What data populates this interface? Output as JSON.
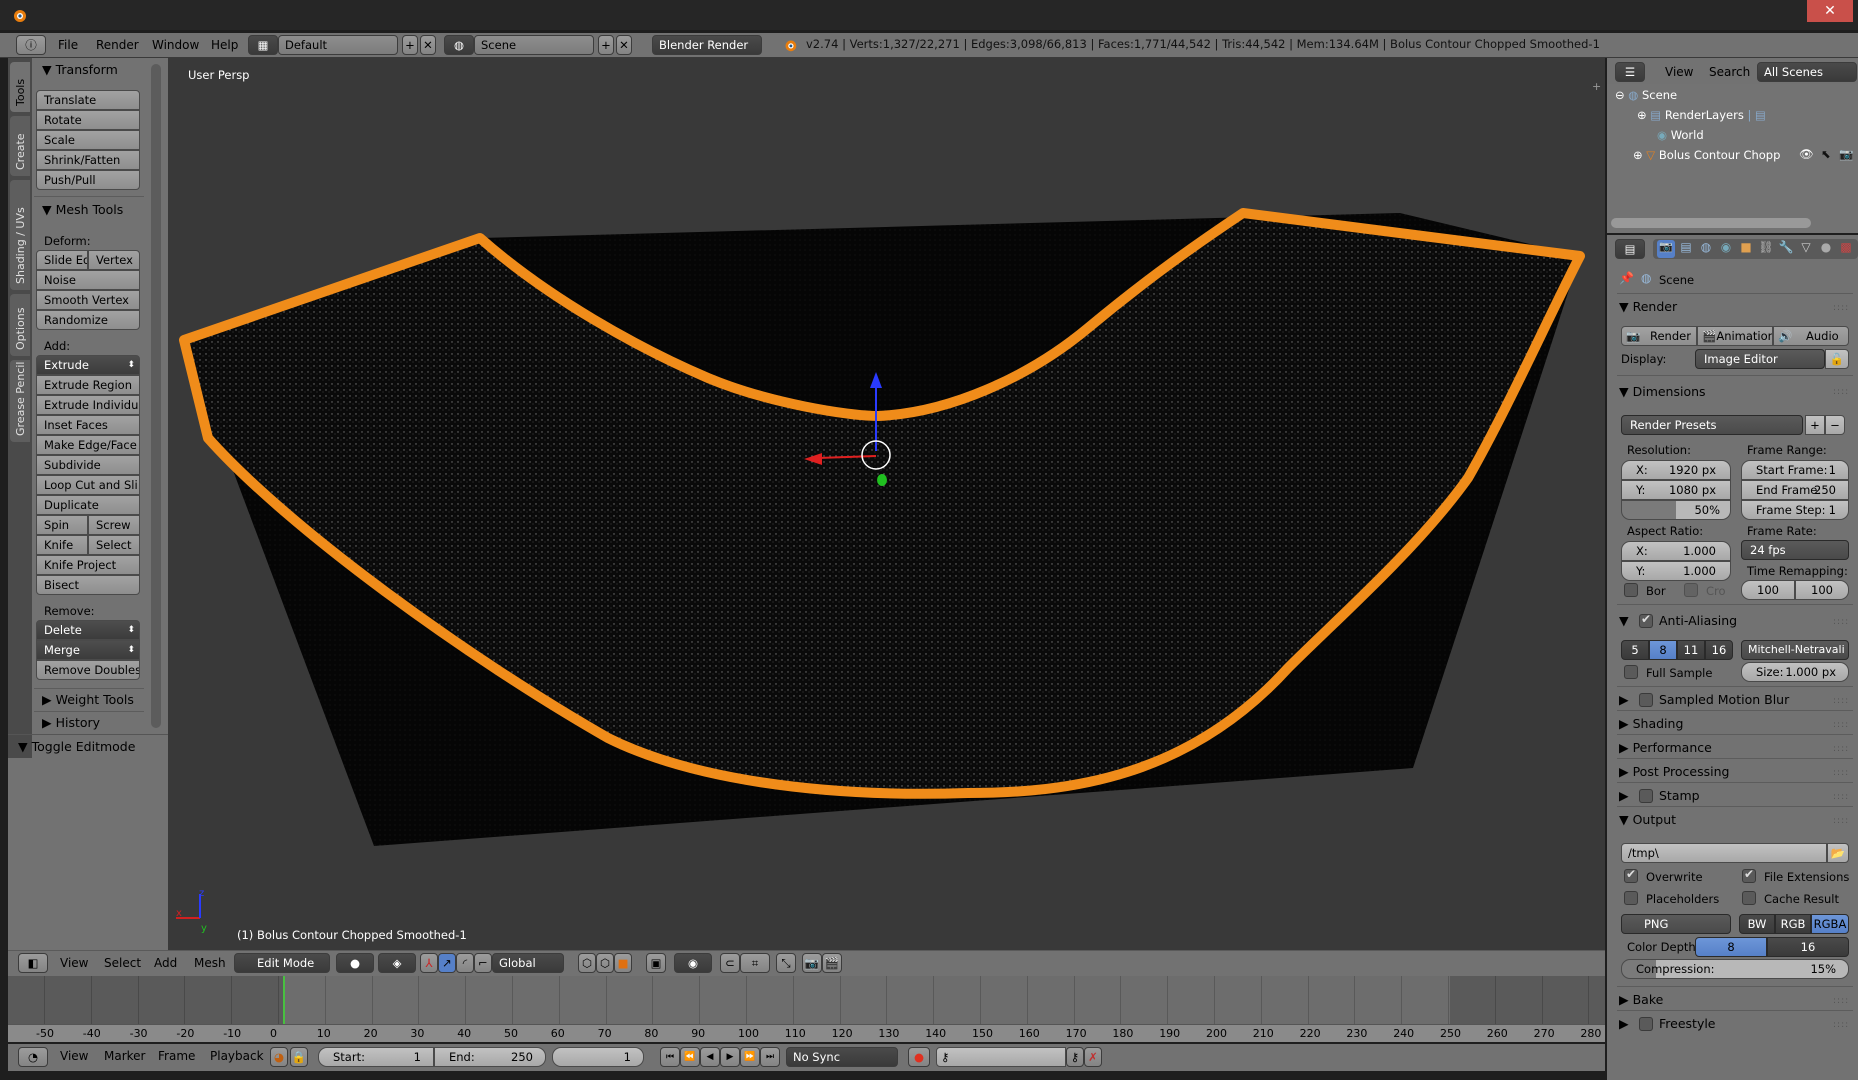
{
  "window": {
    "close_icon": "✕"
  },
  "info_header": {
    "menus": [
      "File",
      "Render",
      "Window",
      "Help"
    ],
    "screen_layout": "Default",
    "scene": "Scene",
    "render_engine": "Blender Render",
    "stats": "v2.74 | Verts:1,327/22,271 | Edges:3,098/66,813 | Faces:1,771/44,542 | Tris:44,542 | Mem:134.64M | Bolus Contour Chopped Smoothed-1"
  },
  "toolshelf": {
    "tabs": [
      "Tools",
      "Create",
      "Shading / UVs",
      "Options",
      "Grease Pencil"
    ],
    "transform": {
      "title": "Transform",
      "buttons": [
        "Translate",
        "Rotate",
        "Scale",
        "Shrink/Fatten",
        "Push/Pull"
      ]
    },
    "mesh_tools": {
      "title": "Mesh Tools",
      "deform_label": "Deform:",
      "deform": [
        "Slide Ed",
        "Vertex",
        "Noise",
        "Smooth Vertex",
        "Randomize"
      ],
      "add_label": "Add:",
      "extrude": "Extrude",
      "add": [
        "Extrude Region",
        "Extrude Individual",
        "Inset Faces",
        "Make Edge/Face",
        "Subdivide",
        "Loop Cut and Sli...",
        "Duplicate",
        "Spin",
        "Screw",
        "Knife",
        "Select",
        "Knife Project",
        "Bisect"
      ],
      "remove_label": "Remove:",
      "delete": "Delete",
      "merge": "Merge",
      "remove_doubles": "Remove Doubles"
    },
    "weight_tools": "Weight Tools",
    "history": "History",
    "toggle_editmode": "Toggle Editmode"
  },
  "viewport": {
    "view_label": "User Persp",
    "object_label": "(1) Bolus Contour Chopped Smoothed-1",
    "axis_labels": {
      "x": "x",
      "y": "y",
      "z": "z"
    }
  },
  "viewport_header": {
    "menus": [
      "View",
      "Select",
      "Add",
      "Mesh"
    ],
    "mode": "Edit Mode",
    "orientation": "Global"
  },
  "timeline": {
    "ruler_ticks": [
      "-50",
      "-40",
      "-30",
      "-20",
      "-10",
      "0",
      "10",
      "20",
      "30",
      "40",
      "50",
      "60",
      "70",
      "80",
      "90",
      "100",
      "110",
      "120",
      "130",
      "140",
      "150",
      "160",
      "170",
      "180",
      "190",
      "200",
      "210",
      "220",
      "230",
      "240",
      "250",
      "260",
      "270",
      "280"
    ],
    "current_frame_marker": 0,
    "menus": [
      "View",
      "Marker",
      "Frame",
      "Playback"
    ],
    "start_label": "Start:",
    "start": "1",
    "end_label": "End:",
    "end": "250",
    "current": "1",
    "sync": "No Sync"
  },
  "outliner": {
    "menus": [
      "View",
      "Search"
    ],
    "filter": "All Scenes",
    "items": [
      "Scene",
      "RenderLayers",
      "World",
      "Bolus Contour Chopped S"
    ]
  },
  "properties": {
    "context": "Scene",
    "render": {
      "title": "Render",
      "buttons": [
        "Render",
        "Animation",
        "Audio"
      ],
      "display_label": "Display:",
      "display": "Image Editor"
    },
    "dimensions": {
      "title": "Dimensions",
      "presets": "Render Presets",
      "resolution_label": "Resolution:",
      "res_x": "1920 px",
      "res_y": "1080 px",
      "res_pct": "50%",
      "res_pct_value": 50,
      "frame_range_label": "Frame Range:",
      "start_frame_label": "Start Frame:",
      "start_frame": "1",
      "end_frame_label": "End Frame:",
      "end_frame": "250",
      "frame_step_label": "Frame Step:",
      "frame_step": "1",
      "aspect_label": "Aspect Ratio:",
      "aspect_x": "1.000",
      "aspect_y": "1.000",
      "frame_rate_label": "Frame Rate:",
      "frame_rate": "24 fps",
      "time_remap_label": "Time Remapping:",
      "remap_old": "100",
      "remap_new": "100",
      "border": "Bor",
      "crop": "Cro"
    },
    "anti_aliasing": {
      "title": "Anti-Aliasing",
      "enabled": true,
      "samples": [
        "5",
        "8",
        "11",
        "16"
      ],
      "selected": "8",
      "filter": "Mitchell-Netravali",
      "full_sample": "Full Sample",
      "size_label": "Size:",
      "size": "1.000 px"
    },
    "collapsed": [
      "Sampled Motion Blur",
      "Shading",
      "Performance",
      "Post Processing",
      "Stamp"
    ],
    "output": {
      "title": "Output",
      "path": "/tmp\\",
      "overwrite": "Overwrite",
      "file_extensions": "File Extensions",
      "placeholders": "Placeholders",
      "cache_result": "Cache Result",
      "format": "PNG",
      "color_modes": [
        "BW",
        "RGB",
        "RGBA"
      ],
      "color_mode": "RGBA",
      "color_depth_label": "Color Depth:",
      "depths": [
        "8",
        "16"
      ],
      "depth": "8",
      "compression_label": "Compression:",
      "compression": "15%",
      "compression_value": 15
    },
    "bake": "Bake",
    "freestyle": "Freestyle"
  }
}
